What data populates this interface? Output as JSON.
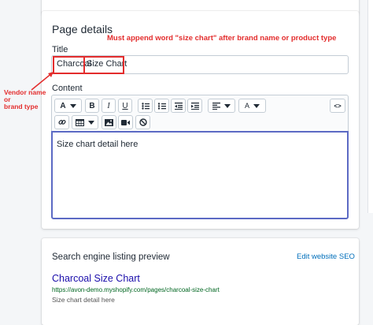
{
  "page_details": {
    "heading": "Page details",
    "title_label": "Title",
    "title_value_vendor": "Charcoal",
    "title_value_suffix": "Size Chart",
    "content_label": "Content",
    "editor_body": "Size chart detail here"
  },
  "annotations": {
    "top_note": "Must append word \"size chart\" after brand name or product type",
    "left_note_lines": [
      "Vendor name",
      "or",
      "brand type"
    ],
    "color": "#e32d2d"
  },
  "toolbar": {
    "row1": [
      {
        "name": "text-style-dropdown",
        "icon": "font-icon",
        "label": "A"
      },
      {
        "name": "bold-button",
        "icon": "bold-icon",
        "label": "B"
      },
      {
        "name": "italic-button",
        "icon": "italic-icon",
        "label": "I"
      },
      {
        "name": "underline-button",
        "icon": "underline-icon",
        "label": "U"
      },
      {
        "name": "bullet-list-button",
        "icon": "bullet-list-icon"
      },
      {
        "name": "numbered-list-button",
        "icon": "numbered-list-icon"
      },
      {
        "name": "outdent-button",
        "icon": "outdent-icon"
      },
      {
        "name": "indent-button",
        "icon": "indent-icon"
      },
      {
        "name": "align-dropdown",
        "icon": "align-left-icon"
      },
      {
        "name": "text-color-dropdown",
        "icon": "text-color-icon",
        "label": "A"
      },
      {
        "name": "show-html-button",
        "icon": "code-icon",
        "label": "<>"
      }
    ],
    "row2": [
      {
        "name": "insert-link-button",
        "icon": "link-icon"
      },
      {
        "name": "insert-table-dropdown",
        "icon": "table-icon"
      },
      {
        "name": "insert-image-button",
        "icon": "image-icon"
      },
      {
        "name": "insert-video-button",
        "icon": "video-icon"
      },
      {
        "name": "clear-formatting-button",
        "icon": "clear-formatting-icon"
      }
    ]
  },
  "seo": {
    "heading": "Search engine listing preview",
    "edit_link": "Edit website SEO",
    "preview_title": "Charcoal Size Chart",
    "preview_url": "https://avon-demo.myshopify.com/pages/charcoal-size-chart",
    "preview_description": "Size chart detail here"
  },
  "colors": {
    "accent": "#5c6ac4",
    "link": "#006fbb",
    "seo_title": "#1a0dab",
    "seo_url": "#006621"
  }
}
